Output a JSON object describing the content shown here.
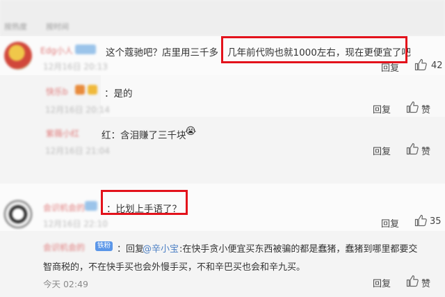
{
  "tabs": [
    "按热度",
    "按时间"
  ],
  "comments": [
    {
      "text_a": "这个蔻驰吧？店里用三千多 ",
      "text_b": "几年前代购也就1000左右，现在更便宜了吧",
      "reply": "回复",
      "likes": "42",
      "name": "Edg小人",
      "time": "12月16日 20:13"
    },
    {
      "text": "：是的",
      "time": "12月16日 20:14",
      "reply": "回复",
      "likes": "赞",
      "name": "快乐b"
    },
    {
      "text": "红：含泪赚了三千块",
      "time": "12月16日 21:04",
      "reply": "回复",
      "likes": "赞",
      "name": "紫薇小红"
    },
    {
      "text": "：比划上手语了？",
      "reply": "回复",
      "likes": "35",
      "name": "会识机会的"
    },
    {
      "tag": "铁粉",
      "prefix": "：回复",
      "mention": "@辛小宝",
      "line1": ":在快手贪小便宜买东西被骗的都是蠢猪，蠢猪到哪里都要交",
      "line2": "智商税的，不在快手买也会外慢手买，不和辛巴买也会和辛九买。",
      "time": "今天 02:49",
      "reply": "回复",
      "likes": "赞",
      "name": "会识机会的"
    }
  ],
  "colors": {
    "highlight": "#e3121b",
    "link": "#4b7fc4",
    "fan_badge": "#5b96e8"
  }
}
